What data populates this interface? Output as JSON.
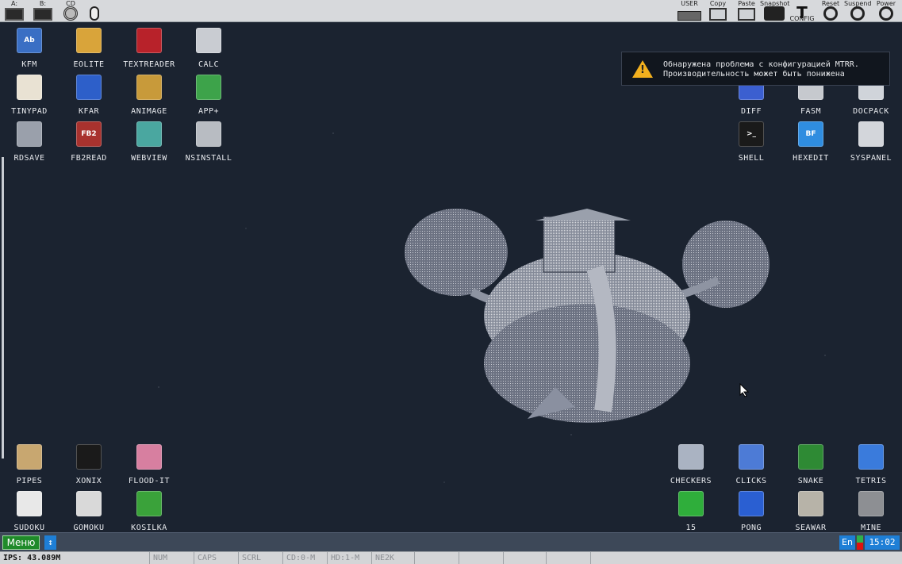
{
  "topbar": {
    "left": [
      {
        "caption": "A:",
        "icon": "floppy-drive-icon",
        "glyph": "drive"
      },
      {
        "caption": "B:",
        "icon": "floppy-drive-icon",
        "glyph": "drive"
      },
      {
        "caption": "CD",
        "icon": "cd-drive-icon",
        "glyph": "cd"
      },
      {
        "caption": "",
        "icon": "mouse-icon",
        "glyph": "mouse"
      }
    ],
    "right": [
      {
        "caption": "USER",
        "icon": "keyboard-icon",
        "glyph": "kbd"
      },
      {
        "caption": "Copy",
        "icon": "copy-icon",
        "glyph": "box"
      },
      {
        "caption": "Paste",
        "icon": "paste-icon",
        "glyph": "box"
      },
      {
        "caption": "Snapshot",
        "icon": "camera-icon",
        "glyph": "cam"
      },
      {
        "caption": "",
        "icon": "config-icon",
        "big": "T",
        "sub": "CONFIG"
      },
      {
        "caption": "Reset",
        "icon": "reset-icon",
        "glyph": "power"
      },
      {
        "caption": "Suspend",
        "icon": "suspend-icon",
        "glyph": "power"
      },
      {
        "caption": "Power",
        "icon": "power-icon",
        "glyph": "power"
      }
    ]
  },
  "desktop": {
    "icons_top_left": [
      {
        "label": "KFM",
        "icon": "kfm-icon",
        "color": "#3a6fc4",
        "mark": "Ab"
      },
      {
        "label": "EOLITE",
        "icon": "eolite-icon",
        "color": "#d9a43a",
        "mark": ""
      },
      {
        "label": "TEXTREADER",
        "icon": "textreader-icon",
        "color": "#b8222a",
        "mark": ""
      },
      {
        "label": "CALC",
        "icon": "calc-icon",
        "color": "#c9ccd2",
        "mark": ""
      },
      {
        "label": "TINYPAD",
        "icon": "tinypad-icon",
        "color": "#e9e2d3",
        "mark": ""
      },
      {
        "label": "KFAR",
        "icon": "kfar-icon",
        "color": "#2d5fc9",
        "mark": ""
      },
      {
        "label": "ANIMAGE",
        "icon": "animage-icon",
        "color": "#c89a3a",
        "mark": ""
      },
      {
        "label": "APP+",
        "icon": "app-plus-icon",
        "color": "#3da34a",
        "mark": ""
      },
      {
        "label": "RDSAVE",
        "icon": "rdsave-icon",
        "color": "#9aa0ab",
        "mark": ""
      },
      {
        "label": "FB2READ",
        "icon": "fb2read-icon",
        "color": "#a8322e",
        "mark": "FB2"
      },
      {
        "label": "WEBVIEW",
        "icon": "webview-icon",
        "color": "#4aa7a0",
        "mark": ""
      },
      {
        "label": "NSINSTALL",
        "icon": "nsinstall-icon",
        "color": "#b8bcc2",
        "mark": ""
      }
    ],
    "icons_top_right": [
      {
        "label": "DIFF",
        "icon": "diff-icon",
        "color": "#3b5fd0",
        "mark": ""
      },
      {
        "label": "FASM",
        "icon": "fasm-icon",
        "color": "#c6c9ce",
        "mark": ""
      },
      {
        "label": "DOCPACK",
        "icon": "docpack-icon",
        "color": "#d0d4da",
        "mark": ""
      },
      {
        "label": "SHELL",
        "icon": "shell-icon",
        "color": "#1a1a1a",
        "mark": ">_"
      },
      {
        "label": "HEXEDIT",
        "icon": "hexedit-icon",
        "color": "#2f8de0",
        "mark": "BF"
      },
      {
        "label": "SYSPANEL",
        "icon": "syspanel-icon",
        "color": "#d3d6db",
        "mark": ""
      }
    ],
    "icons_bottom_left": [
      {
        "label": "PIPES",
        "icon": "pipes-icon",
        "color": "#c8a770",
        "mark": ""
      },
      {
        "label": "XONIX",
        "icon": "xonix-icon",
        "color": "#1a1a1a",
        "mark": ""
      },
      {
        "label": "FLOOD-IT",
        "icon": "flood-it-icon",
        "color": "#d77fa0",
        "mark": ""
      },
      {
        "label": "SUDOKU",
        "icon": "sudoku-icon",
        "color": "#e8e8e8",
        "mark": ""
      },
      {
        "label": "GOMOKU",
        "icon": "gomoku-icon",
        "color": "#d9d9d9",
        "mark": ""
      },
      {
        "label": "KOSILKA",
        "icon": "kosilka-icon",
        "color": "#3aa23a",
        "mark": ""
      }
    ],
    "icons_bottom_right": [
      {
        "label": "CHECKERS",
        "icon": "checkers-icon",
        "color": "#aab3c2",
        "mark": ""
      },
      {
        "label": "CLICKS",
        "icon": "clicks-icon",
        "color": "#4d7bd6",
        "mark": ""
      },
      {
        "label": "SNAKE",
        "icon": "snake-icon",
        "color": "#2e8a34",
        "mark": ""
      },
      {
        "label": "TETRIS",
        "icon": "tetris-icon",
        "color": "#3a7bdc",
        "mark": ""
      },
      {
        "label": "15",
        "icon": "fifteen-icon",
        "color": "#2fae3b",
        "mark": ""
      },
      {
        "label": "PONG",
        "icon": "pong-icon",
        "color": "#2a5fd2",
        "mark": ""
      },
      {
        "label": "SEAWAR",
        "icon": "seawar-icon",
        "color": "#b7b3a8",
        "mark": ""
      },
      {
        "label": "MINE",
        "icon": "mine-icon",
        "color": "#8d8f93",
        "mark": ""
      }
    ]
  },
  "notification": {
    "icon": "warning-icon",
    "line1": "Обнаружена проблема с конфигурацией MTRR.",
    "line2": "Производительность может быть понижена"
  },
  "taskbar": {
    "menu_label": "Меню",
    "switch_label": "↕",
    "lang": "En",
    "time": "15:02"
  },
  "statusbar": {
    "ips": "IPS: 43.089M",
    "num": "NUM",
    "caps": "CAPS",
    "scrl": "SCRL",
    "disk": "CD:0-M",
    "hd": "HD:1-M",
    "net": "NE2K"
  },
  "colors": {
    "desktop_bg": "#1b2330",
    "taskbar_bg": "#3d4858",
    "menu_green": "#1f8a2a",
    "accent_blue": "#1e7fd6",
    "warning_yellow": "#f2b01e"
  }
}
